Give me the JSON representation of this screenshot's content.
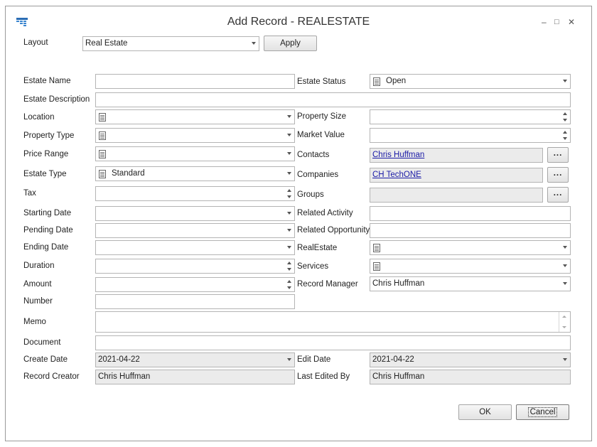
{
  "window": {
    "title": "Add Record - REALESTATE",
    "app_icon": "grid-table-icon",
    "controls": {
      "minimize": "–",
      "maximize": "□",
      "close": "✕"
    }
  },
  "layout_bar": {
    "label": "Layout",
    "value": "Real Estate",
    "apply_label": "Apply"
  },
  "left": {
    "estate_name": {
      "label": "Estate Name",
      "value": ""
    },
    "estate_description": {
      "label": "Estate Description",
      "value": ""
    },
    "location": {
      "label": "Location",
      "value": ""
    },
    "property_type": {
      "label": "Property Type",
      "value": ""
    },
    "price_range": {
      "label": "Price Range",
      "value": ""
    },
    "estate_type": {
      "label": "Estate Type",
      "value": "Standard"
    },
    "tax": {
      "label": "Tax",
      "value": ""
    },
    "starting_date": {
      "label": "Starting Date",
      "value": ""
    },
    "pending_date": {
      "label": "Pending Date",
      "value": ""
    },
    "ending_date": {
      "label": "Ending Date",
      "value": ""
    },
    "duration": {
      "label": "Duration",
      "value": ""
    },
    "amount": {
      "label": "Amount",
      "value": ""
    },
    "number": {
      "label": "Number",
      "value": ""
    },
    "memo": {
      "label": "Memo",
      "value": ""
    },
    "document": {
      "label": "Document",
      "value": ""
    },
    "create_date": {
      "label": "Create Date",
      "value": "2021-04-22"
    },
    "record_creator": {
      "label": "Record Creator",
      "value": "Chris Huffman"
    }
  },
  "right": {
    "estate_status": {
      "label": "Estate Status",
      "value": "Open"
    },
    "property_size": {
      "label": "Property Size",
      "value": ""
    },
    "market_value": {
      "label": "Market Value",
      "value": ""
    },
    "contacts": {
      "label": "Contacts",
      "value": "Chris Huffman"
    },
    "companies": {
      "label": "Companies",
      "value": "CH TechONE"
    },
    "groups": {
      "label": "Groups",
      "value": ""
    },
    "related_activity": {
      "label": "Related Activity",
      "value": ""
    },
    "related_opportunity": {
      "label": "Related Opportunity",
      "value": ""
    },
    "realestate": {
      "label": "RealEstate",
      "value": ""
    },
    "services": {
      "label": "Services",
      "value": ""
    },
    "record_manager": {
      "label": "Record Manager",
      "value": "Chris Huffman"
    },
    "edit_date": {
      "label": "Edit Date",
      "value": "2021-04-22"
    },
    "last_edited_by": {
      "label": "Last Edited By",
      "value": "Chris Huffman"
    }
  },
  "browse_label": "...",
  "footer": {
    "ok_label": "OK",
    "cancel_label": "Cancel"
  }
}
